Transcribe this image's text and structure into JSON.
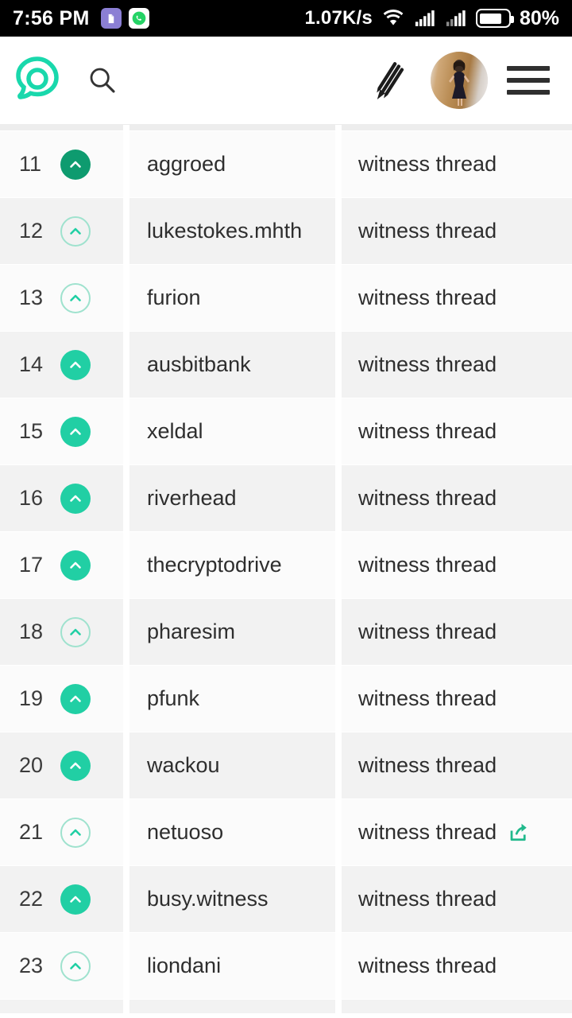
{
  "statusbar": {
    "time": "7:56 PM",
    "network_speed": "1.07K/s",
    "battery_percent": "80%",
    "icons": [
      "app-icon-purple",
      "whatsapp-icon",
      "wifi-icon",
      "signal-icon-1",
      "signal-icon-2",
      "battery-icon"
    ]
  },
  "appbar": {
    "logo_name": "busy-logo",
    "search_label": "search-icon",
    "compose_label": "pencil-icon",
    "avatar_label": "user-avatar",
    "menu_label": "hamburger-menu-icon"
  },
  "colors": {
    "accent": "#21cfa4",
    "accent_dark": "#0e9b6f",
    "accent_outline": "#9fe2ce",
    "row_light": "#fbfbfb",
    "row_alt": "#f2f2f2",
    "text": "#2e2e2e",
    "status_bg": "#000000"
  },
  "table": {
    "link_text": "witness thread",
    "rows": [
      {
        "rank": "11",
        "name": "aggroed",
        "link": "witness thread",
        "vote": "filled-dark",
        "share": false
      },
      {
        "rank": "12",
        "name": "lukestokes.mhth",
        "link": "witness thread",
        "vote": "outline",
        "share": false
      },
      {
        "rank": "13",
        "name": "furion",
        "link": "witness thread",
        "vote": "outline",
        "share": false
      },
      {
        "rank": "14",
        "name": "ausbitbank",
        "link": "witness thread",
        "vote": "filled",
        "share": false
      },
      {
        "rank": "15",
        "name": "xeldal",
        "link": "witness thread",
        "vote": "filled",
        "share": false
      },
      {
        "rank": "16",
        "name": "riverhead",
        "link": "witness thread",
        "vote": "filled",
        "share": false
      },
      {
        "rank": "17",
        "name": "thecryptodrive",
        "link": "witness thread",
        "vote": "filled",
        "share": false
      },
      {
        "rank": "18",
        "name": "pharesim",
        "link": "witness thread",
        "vote": "outline",
        "share": false
      },
      {
        "rank": "19",
        "name": "pfunk",
        "link": "witness thread",
        "vote": "filled",
        "share": false
      },
      {
        "rank": "20",
        "name": "wackou",
        "link": "witness thread",
        "vote": "filled",
        "share": false
      },
      {
        "rank": "21",
        "name": "netuoso",
        "link": "witness thread",
        "vote": "outline",
        "share": true
      },
      {
        "rank": "22",
        "name": "busy.witness",
        "link": "witness thread",
        "vote": "filled",
        "share": false
      },
      {
        "rank": "23",
        "name": "liondani",
        "link": "witness thread",
        "vote": "outline",
        "share": false
      }
    ]
  }
}
